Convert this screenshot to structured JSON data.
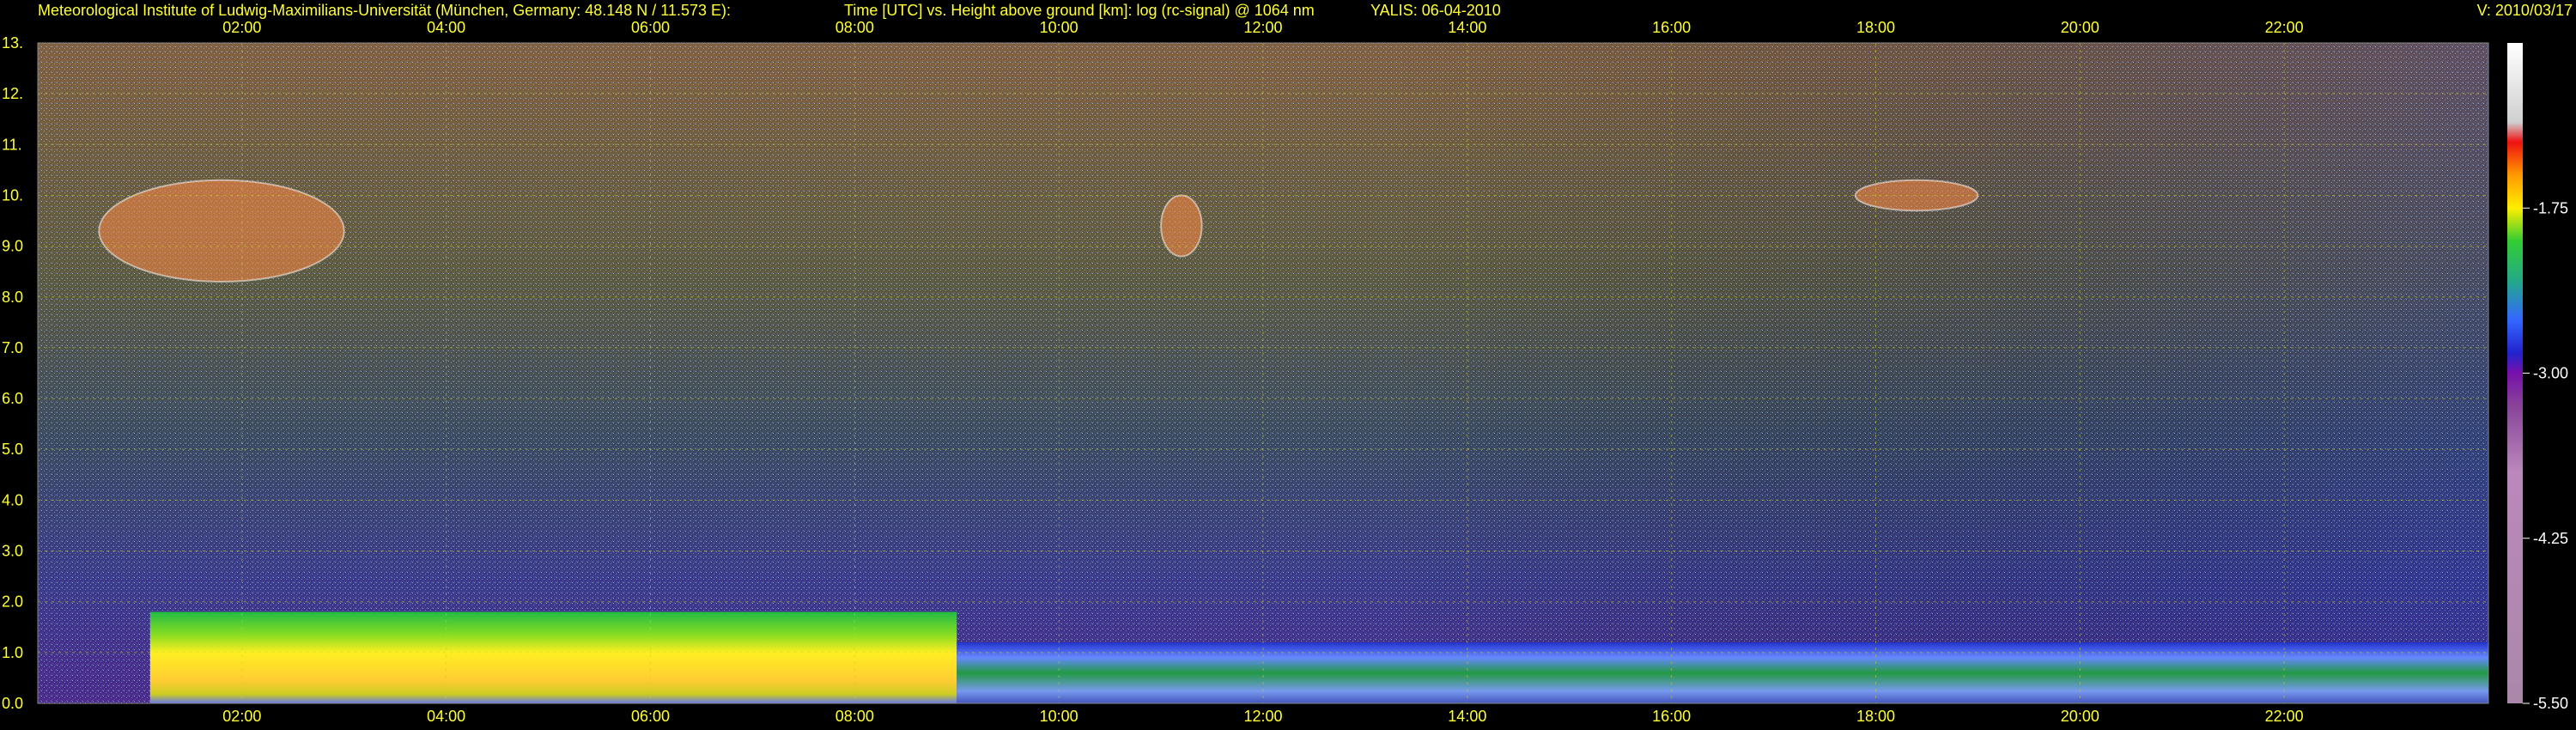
{
  "header": {
    "institute": "Meteorological Institute of Ludwig-Maximilians-Universität (München, Germany: 48.148 N / 11.573 E):",
    "axes_title": "Time [UTC] vs. Height above ground [km]: log (rc-signal) @ 1064 nm",
    "station": "YALIS: 06-04-2010",
    "version": "V: 2010/03/17"
  },
  "chart_data": {
    "type": "heatmap",
    "title": "Time [UTC] vs. Height above ground [km]: log (rc-signal) @ 1064 nm",
    "xlabel": "Time [UTC]",
    "ylabel": "Height above ground [km]",
    "xlim": [
      0,
      24
    ],
    "ylim": [
      0,
      13
    ],
    "x_ticks": [
      "02:00",
      "04:00",
      "06:00",
      "08:00",
      "10:00",
      "12:00",
      "14:00",
      "16:00",
      "18:00",
      "20:00",
      "22:00"
    ],
    "x_tick_values": [
      2,
      4,
      6,
      8,
      10,
      12,
      14,
      16,
      18,
      20,
      22
    ],
    "y_ticks": [
      "0.0",
      "1.0",
      "2.0",
      "3.0",
      "4.0",
      "5.0",
      "6.0",
      "7.0",
      "8.0",
      "9.0",
      "10.",
      "11.",
      "12.",
      "13."
    ],
    "y_tick_values": [
      0,
      1,
      2,
      3,
      4,
      5,
      6,
      7,
      8,
      9,
      10,
      11,
      12,
      13
    ],
    "colorbar": {
      "labels": [
        "-1.75",
        "-3.00",
        "-4.25",
        "-5.50"
      ],
      "values": [
        -1.75,
        -3.0,
        -4.25,
        -5.5
      ],
      "range": [
        -5.5,
        -0.5
      ]
    },
    "grid": true,
    "features": [
      {
        "kind": "boundary-layer-aerosol",
        "x_range": [
          1.1,
          9.0
        ],
        "height_km": [
          0.0,
          1.8
        ]
      },
      {
        "kind": "boundary-layer-aerosol",
        "x_range": [
          9.0,
          24.0
        ],
        "height_km": [
          0.0,
          1.2
        ]
      },
      {
        "kind": "cirrus",
        "x_range": [
          0.6,
          3.0
        ],
        "height_km": [
          8.3,
          10.3
        ]
      },
      {
        "kind": "cirrus",
        "x_range": [
          11.0,
          11.4
        ],
        "height_km": [
          8.8,
          10.0
        ]
      },
      {
        "kind": "cirrus",
        "x_range": [
          17.8,
          19.0
        ],
        "height_km": [
          9.7,
          10.3
        ]
      }
    ]
  }
}
